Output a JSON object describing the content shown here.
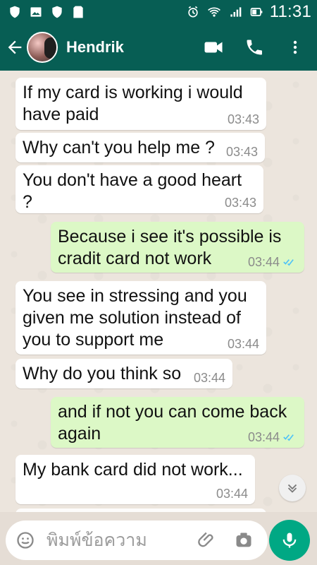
{
  "status_bar": {
    "time": "11:31",
    "left_icons": [
      "shield-icon",
      "image-icon",
      "shield-icon",
      "sd-card-icon"
    ],
    "right_icons": [
      "alarm-icon",
      "wifi-icon",
      "signal-icon",
      "battery-icon"
    ]
  },
  "header": {
    "contact_name": "Hendrik",
    "actions": [
      "video-call-icon",
      "phone-icon",
      "more-icon"
    ]
  },
  "messages": [
    {
      "direction": "incoming",
      "text": "If my card is working i would have paid",
      "time": "03:43"
    },
    {
      "direction": "incoming",
      "text": "Why can't you help me ?",
      "time": "03:43"
    },
    {
      "direction": "incoming",
      "text": "You don't have a good heart ?",
      "time": "03:43"
    },
    {
      "direction": "outgoing",
      "text": "Because i see it's possible is cradit card not work",
      "time": "03:44",
      "status": "read"
    },
    {
      "direction": "incoming",
      "text": "You see in stressing and you given me solution instead of you to support me",
      "time": "03:44"
    },
    {
      "direction": "incoming",
      "text": "Why do you think so",
      "time": "03:44"
    },
    {
      "direction": "outgoing",
      "text": "and if not you can come back again",
      "time": "03:44",
      "status": "read"
    },
    {
      "direction": "incoming",
      "text": "My bank card did not work...",
      "time": "03:44"
    }
  ],
  "composer": {
    "placeholder": "พิมพ์ข้อความ",
    "icons": [
      "emoji-icon",
      "attachment-icon",
      "camera-icon",
      "microphone-icon"
    ]
  },
  "colors": {
    "brand": "#075e54",
    "accent": "#00a884",
    "incoming_bubble": "#ffffff",
    "outgoing_bubble": "#dcf8c6",
    "read_ticks": "#4fc3f7"
  }
}
